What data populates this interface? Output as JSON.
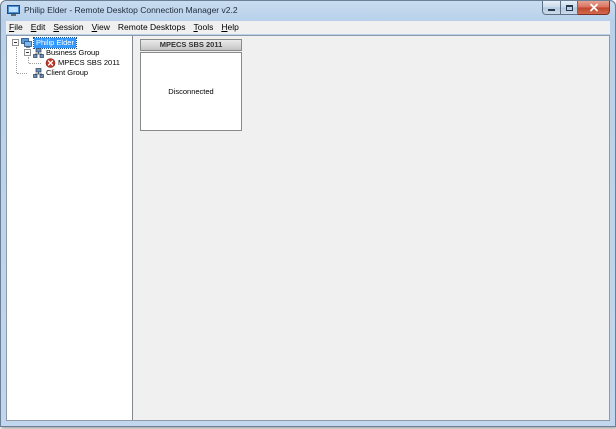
{
  "window": {
    "title": "Philip Elder - Remote Desktop Connection Manager v2.2"
  },
  "menu": {
    "items": [
      {
        "label": "File",
        "mnemonic": "F",
        "rest": "ile"
      },
      {
        "label": "Edit",
        "mnemonic": "E",
        "rest": "dit"
      },
      {
        "label": "Session",
        "mnemonic": "S",
        "rest": "ession"
      },
      {
        "label": "View",
        "mnemonic": "V",
        "rest": "iew"
      },
      {
        "label": "Remote Desktops",
        "mnemonic": "",
        "rest": "Remote Desktops"
      },
      {
        "label": "Tools",
        "mnemonic": "T",
        "rest": "ools"
      },
      {
        "label": "Help",
        "mnemonic": "H",
        "rest": "elp"
      }
    ]
  },
  "tree": {
    "root": {
      "label": "Philip Elder",
      "icon": "computers-root-icon",
      "selected": true
    },
    "groups": [
      {
        "label": "Business Group",
        "icon": "group-network-icon",
        "children": [
          {
            "label": "MPECS SBS 2011",
            "icon": "error-x-icon",
            "status_color": "#c0392b"
          }
        ]
      },
      {
        "label": "Client Group",
        "icon": "group-network-icon",
        "children": []
      }
    ]
  },
  "thumbnails": [
    {
      "title": "MPECS SBS 2011",
      "status": "Disconnected"
    }
  ],
  "colors": {
    "selection": "#3399ff",
    "pane_background": "#f0f0f0",
    "error_icon": "#c0392b"
  }
}
